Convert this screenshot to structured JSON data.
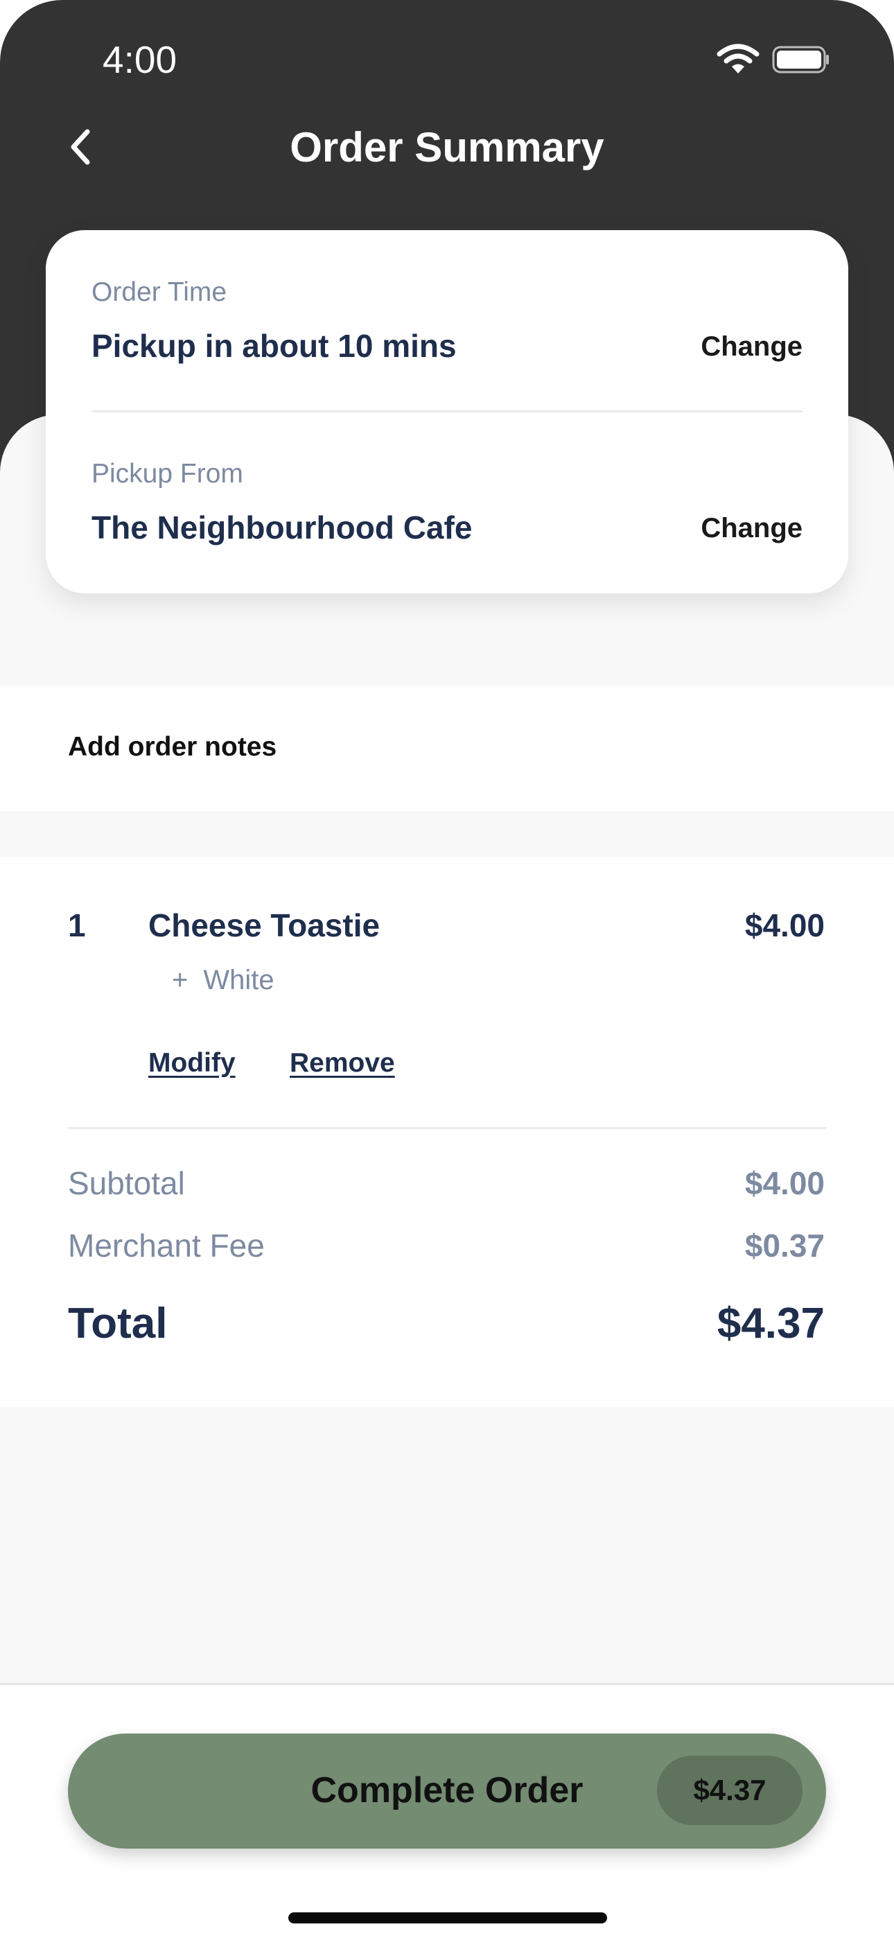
{
  "status_bar": {
    "time": "4:00"
  },
  "header": {
    "title": "Order Summary"
  },
  "order_time": {
    "label": "Order Time",
    "value": "Pickup in about 10 mins",
    "change_label": "Change"
  },
  "pickup_from": {
    "label": "Pickup From",
    "value": "The Neighbourhood Cafe",
    "change_label": "Change"
  },
  "notes": {
    "label": "Add order notes"
  },
  "items": [
    {
      "qty": "1",
      "name": "Cheese Toastie",
      "price": "$4.00",
      "modifier_prefix": "+",
      "modifier": "White",
      "modify_label": "Modify",
      "remove_label": "Remove"
    }
  ],
  "summary": {
    "subtotal_label": "Subtotal",
    "subtotal_value": "$4.00",
    "fee_label": "Merchant Fee",
    "fee_value": "$0.37",
    "total_label": "Total",
    "total_value": "$4.37"
  },
  "cta": {
    "label": "Complete Order",
    "price": "$4.37"
  },
  "colors": {
    "header": "#333333",
    "text_primary": "#1f2e4d",
    "text_muted": "#7d8aa1",
    "cta": "#748c72",
    "cta_price_pill": "#5f735d"
  },
  "icons": {
    "back": "chevron-left-icon",
    "wifi": "wifi-icon",
    "battery": "battery-icon"
  }
}
